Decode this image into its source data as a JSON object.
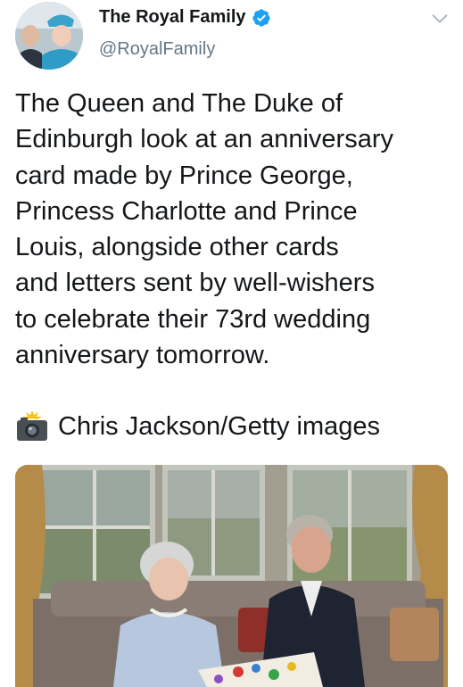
{
  "tweet": {
    "author": {
      "display_name": "The Royal Family",
      "handle": "@RoyalFamily",
      "verified": true,
      "avatar_icon": "avatar-queen-and-duke"
    },
    "text_lines": [
      "The Queen and The Duke of",
      "Edinburgh look at an anniversary",
      "card made by Prince George,",
      "Princess Charlotte and Prince",
      "Louis, alongside other cards",
      "and letters sent by well-wishers",
      "to celebrate their 73rd wedding",
      "anniversary tomorrow."
    ],
    "photo_credit": {
      "icon": "camera-with-flash-icon",
      "text": "Chris Jackson/Getty images"
    },
    "media": {
      "type": "photo",
      "icon": "photo-queen-and-duke-with-cards"
    }
  },
  "colors": {
    "text": "#14171a",
    "secondary_text": "#657786",
    "verified": "#1da1f2",
    "background": "#ffffff"
  }
}
